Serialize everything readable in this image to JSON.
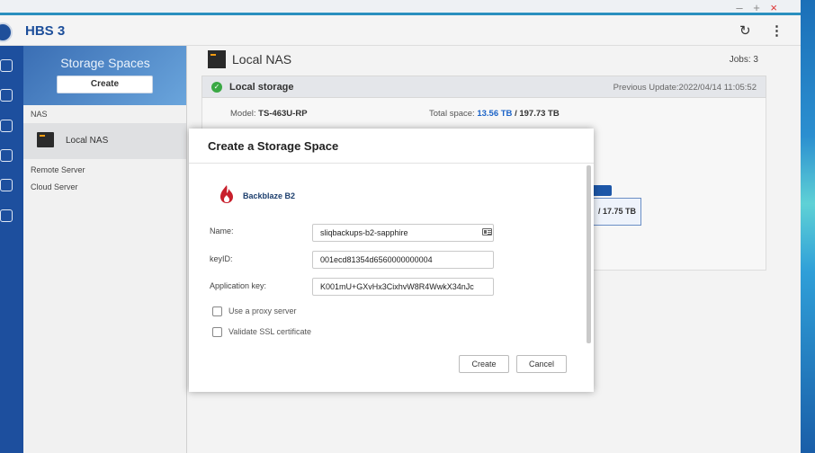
{
  "app": {
    "title": "HBS 3",
    "window_controls": {
      "minimize": "–",
      "maximize": "+",
      "close": "×"
    }
  },
  "sidebar": {
    "title": "Storage Spaces",
    "create_label": "Create",
    "sections": {
      "nas": "NAS",
      "remote": "Remote Server",
      "cloud": "Cloud Server"
    },
    "nas_item": "Local NAS"
  },
  "main": {
    "title": "Local NAS",
    "jobs": "Jobs: 3",
    "local_storage": {
      "label": "Local storage",
      "previous_update": "Previous Update:2022/04/14 11:05:52",
      "model_label": "Model:",
      "model_value": "TS-463U-RP",
      "total_label": "Total space:",
      "total_used": "13.56 TB",
      "total_sep": "/",
      "total_max": "197.73 TB",
      "capacity_fragment": "/ 17.75 TB"
    }
  },
  "dialog": {
    "title": "Create a Storage Space",
    "provider": "Backblaze B2",
    "fields": {
      "name": {
        "label": "Name:",
        "value": "sliqbackups-b2-sapphire"
      },
      "keyid": {
        "label": "keyID:",
        "value": "001ecd81354d6560000000004"
      },
      "appkey": {
        "label": "Application key:",
        "value": "K001mU+GXvHx3CixhvW8R4WwkX34nJc"
      }
    },
    "options": {
      "proxy": {
        "label": "Use a proxy server",
        "checked": false
      },
      "ssl": {
        "label": "Validate SSL certificate",
        "checked": false
      }
    },
    "buttons": {
      "create": "Create",
      "cancel": "Cancel"
    }
  },
  "icons": {
    "app": "hbs-logo-icon",
    "refresh": "refresh-icon",
    "more": "more-vertical-icon",
    "status_ok": "check-circle-icon",
    "provider": "backblaze-flame-icon",
    "card": "contact-card-icon"
  },
  "colors": {
    "brand_blue": "#1c4e9a",
    "accent": "#1c64c8",
    "status_ok": "#3aa844",
    "backblaze_red": "#c8202c"
  }
}
